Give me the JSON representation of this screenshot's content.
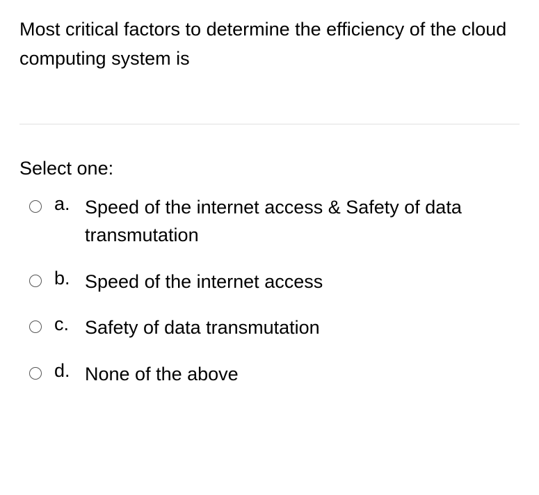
{
  "question": "Most critical factors to determine the efficiency of the cloud computing system is",
  "select_label": "Select one:",
  "options": [
    {
      "letter": "a.",
      "text": "Speed of the internet access & Safety of  data transmutation"
    },
    {
      "letter": "b.",
      "text": "Speed of the internet access"
    },
    {
      "letter": "c.",
      "text": "Safety of  data transmutation"
    },
    {
      "letter": "d.",
      "text": "None of the above"
    }
  ]
}
